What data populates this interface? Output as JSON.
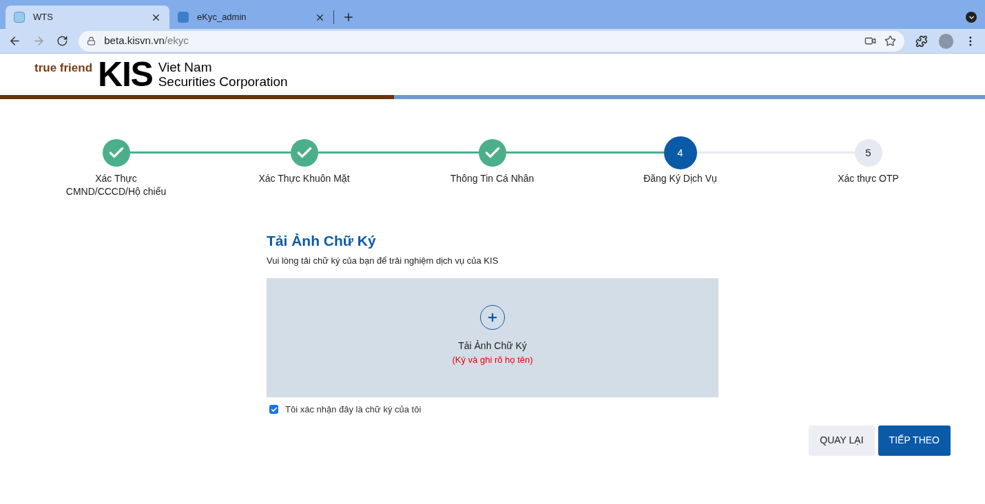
{
  "browser": {
    "tabs": [
      {
        "title": "WTS",
        "selected": true
      },
      {
        "title": "eKyc_admin",
        "selected": false
      }
    ],
    "url_host": "beta.kisvn.vn",
    "url_path": "/ekyc"
  },
  "header": {
    "tagline": "true friend",
    "brand": "KIS",
    "company_line_1": "Viet Nam",
    "company_line_2": "Securities Corporation"
  },
  "steps": [
    {
      "kind": "done",
      "label": "Xác Thực\nCMND/CCCD/Hộ chiếu"
    },
    {
      "kind": "done",
      "label": "Xác Thực Khuôn Mặt"
    },
    {
      "kind": "done",
      "label": "Thông Tin Cá Nhân"
    },
    {
      "kind": "current",
      "number": "4",
      "label": "Đăng Ký Dịch Vụ"
    },
    {
      "kind": "pending",
      "number": "5",
      "label": "Xác thực OTP"
    }
  ],
  "upload": {
    "title": "Tải Ảnh Chữ Ký",
    "subtitle": "Vui lòng tải chữ ký của bạn để trải nghiệm dịch vụ của KIS",
    "drop_label": "Tải Ảnh Chữ Ký",
    "drop_hint": "(Ký và ghi rõ họ tên)"
  },
  "confirm": {
    "label": "Tôi xác nhận đây là chữ ký của tôi",
    "checked": true
  },
  "buttons": [
    {
      "kind": "secondary",
      "label": "QUAY LẠI"
    },
    {
      "kind": "primary",
      "label": "TIẾP THEO"
    }
  ]
}
